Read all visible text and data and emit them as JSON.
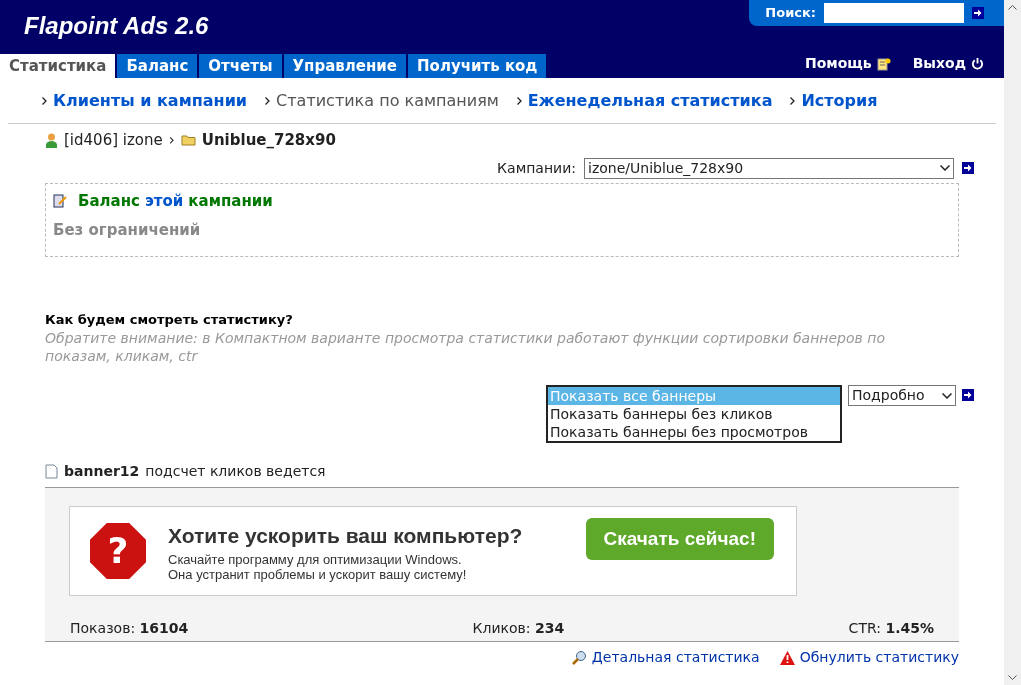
{
  "header": {
    "title": "Flapoint Ads 2.6",
    "search": {
      "label": "Поиск:"
    }
  },
  "tabs": [
    {
      "label": "Статистика",
      "selected": true
    },
    {
      "label": "Баланс",
      "selected": false
    },
    {
      "label": "Отчеты",
      "selected": false
    },
    {
      "label": "Управление",
      "selected": false
    },
    {
      "label": "Получить код",
      "selected": false
    }
  ],
  "header_links": [
    {
      "label": "Помощь",
      "kind": "help"
    },
    {
      "label": "Выход",
      "kind": "logout"
    }
  ],
  "subnav": [
    {
      "label": "Клиенты и кампании",
      "selected": false
    },
    {
      "label": "Статистика по кампаниям",
      "selected": true
    },
    {
      "label": "Еженедельная статистика",
      "selected": false
    },
    {
      "label": "История",
      "selected": false
    }
  ],
  "breadcrumb": {
    "client": "[id406] izone",
    "separator": "›",
    "campaign": "Uniblue_728x90"
  },
  "campaign_select": {
    "label": "Кампании:",
    "value": "izone/Uniblue_728x90"
  },
  "balance": {
    "title_parts": [
      {
        "text": "Баланс",
        "kind": "green"
      },
      {
        "text": "этой",
        "kind": "blue"
      },
      {
        "text": "кампании",
        "kind": "green"
      }
    ],
    "value": "Без ограничений"
  },
  "view": {
    "title": "Как будем смотреть статистику?",
    "note": "Обратите внимание: в Компактном варианте просмотра статистики работают функции сортировки баннеров по показам, кликам, ctr",
    "filter_options": [
      {
        "label": "Показать все баннеры",
        "selected": true
      },
      {
        "label": "Показать баннеры без кликов",
        "selected": false
      },
      {
        "label": "Показать баннеры без просмотров",
        "selected": false
      }
    ],
    "mode_select": {
      "value": "Подробно"
    }
  },
  "banner": {
    "name": "banner12",
    "status": "подсчет кликов ведется",
    "ad": {
      "headline": "Хотите ускорить ваш компьютер?",
      "text_lines": [
        "Скачайте программу для оптимизации Windows.",
        "Она устранит проблемы и ускорит вашу систему!"
      ],
      "button": "Скачать сейчас!",
      "icon_text": "?"
    },
    "stats": [
      {
        "label": "Показов:",
        "value": "16104"
      },
      {
        "label": "Кликов:",
        "value": "234"
      },
      {
        "label": "CTR:",
        "value": "1.45%"
      }
    ],
    "links": [
      {
        "label": "Детальная статистика",
        "kind": "details"
      },
      {
        "label": "Обнулить статистику",
        "kind": "reset"
      }
    ]
  }
}
